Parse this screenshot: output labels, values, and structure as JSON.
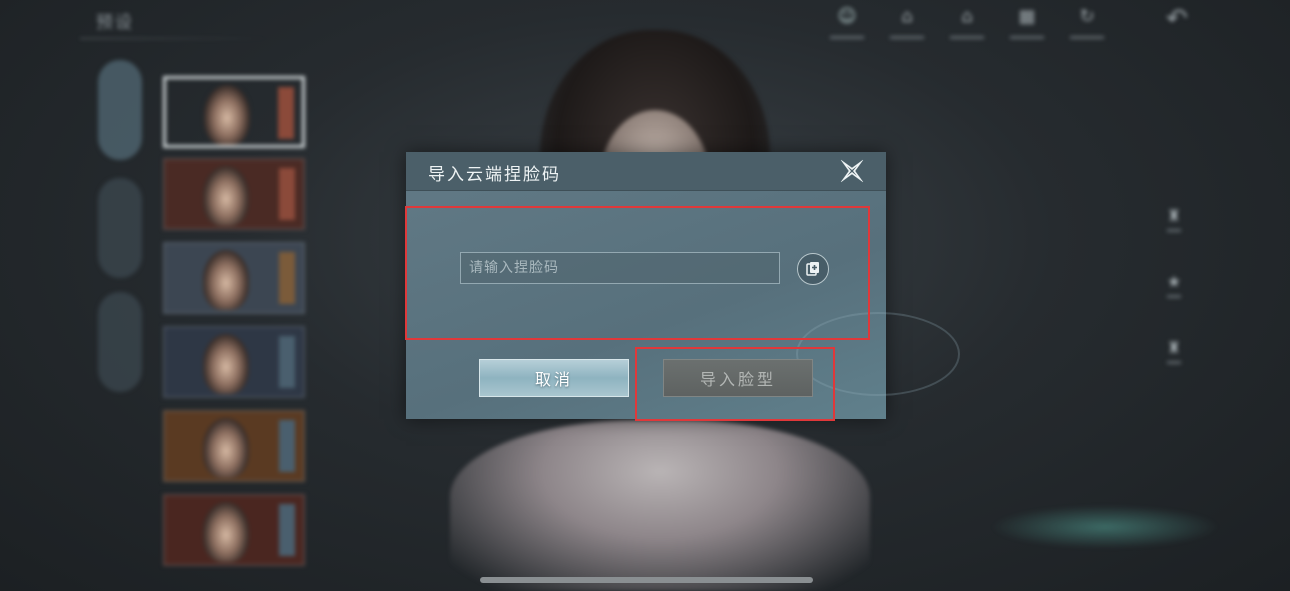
{
  "background": {
    "section_title": "预设",
    "side_tabs": [
      "",
      "",
      ""
    ],
    "top_toolbar": [
      {
        "icon": "face-icon"
      },
      {
        "icon": "house-icon"
      },
      {
        "icon": "house-icon"
      },
      {
        "icon": "grid-icon"
      },
      {
        "icon": "refresh-icon"
      }
    ],
    "right_tools": [
      {
        "icon": "hat-icon"
      },
      {
        "icon": "star-icon"
      },
      {
        "icon": "tag-icon"
      }
    ]
  },
  "dialog": {
    "title": "导入云端捏脸码",
    "input": {
      "value": "",
      "placeholder": "请输入捏脸码"
    },
    "cancel_label": "取消",
    "import_label": "导入脸型",
    "import_enabled": false
  },
  "colors": {
    "highlight": "#e0383a",
    "dialog_bg": "#5b7480",
    "header_bg": "#4b5f69"
  }
}
